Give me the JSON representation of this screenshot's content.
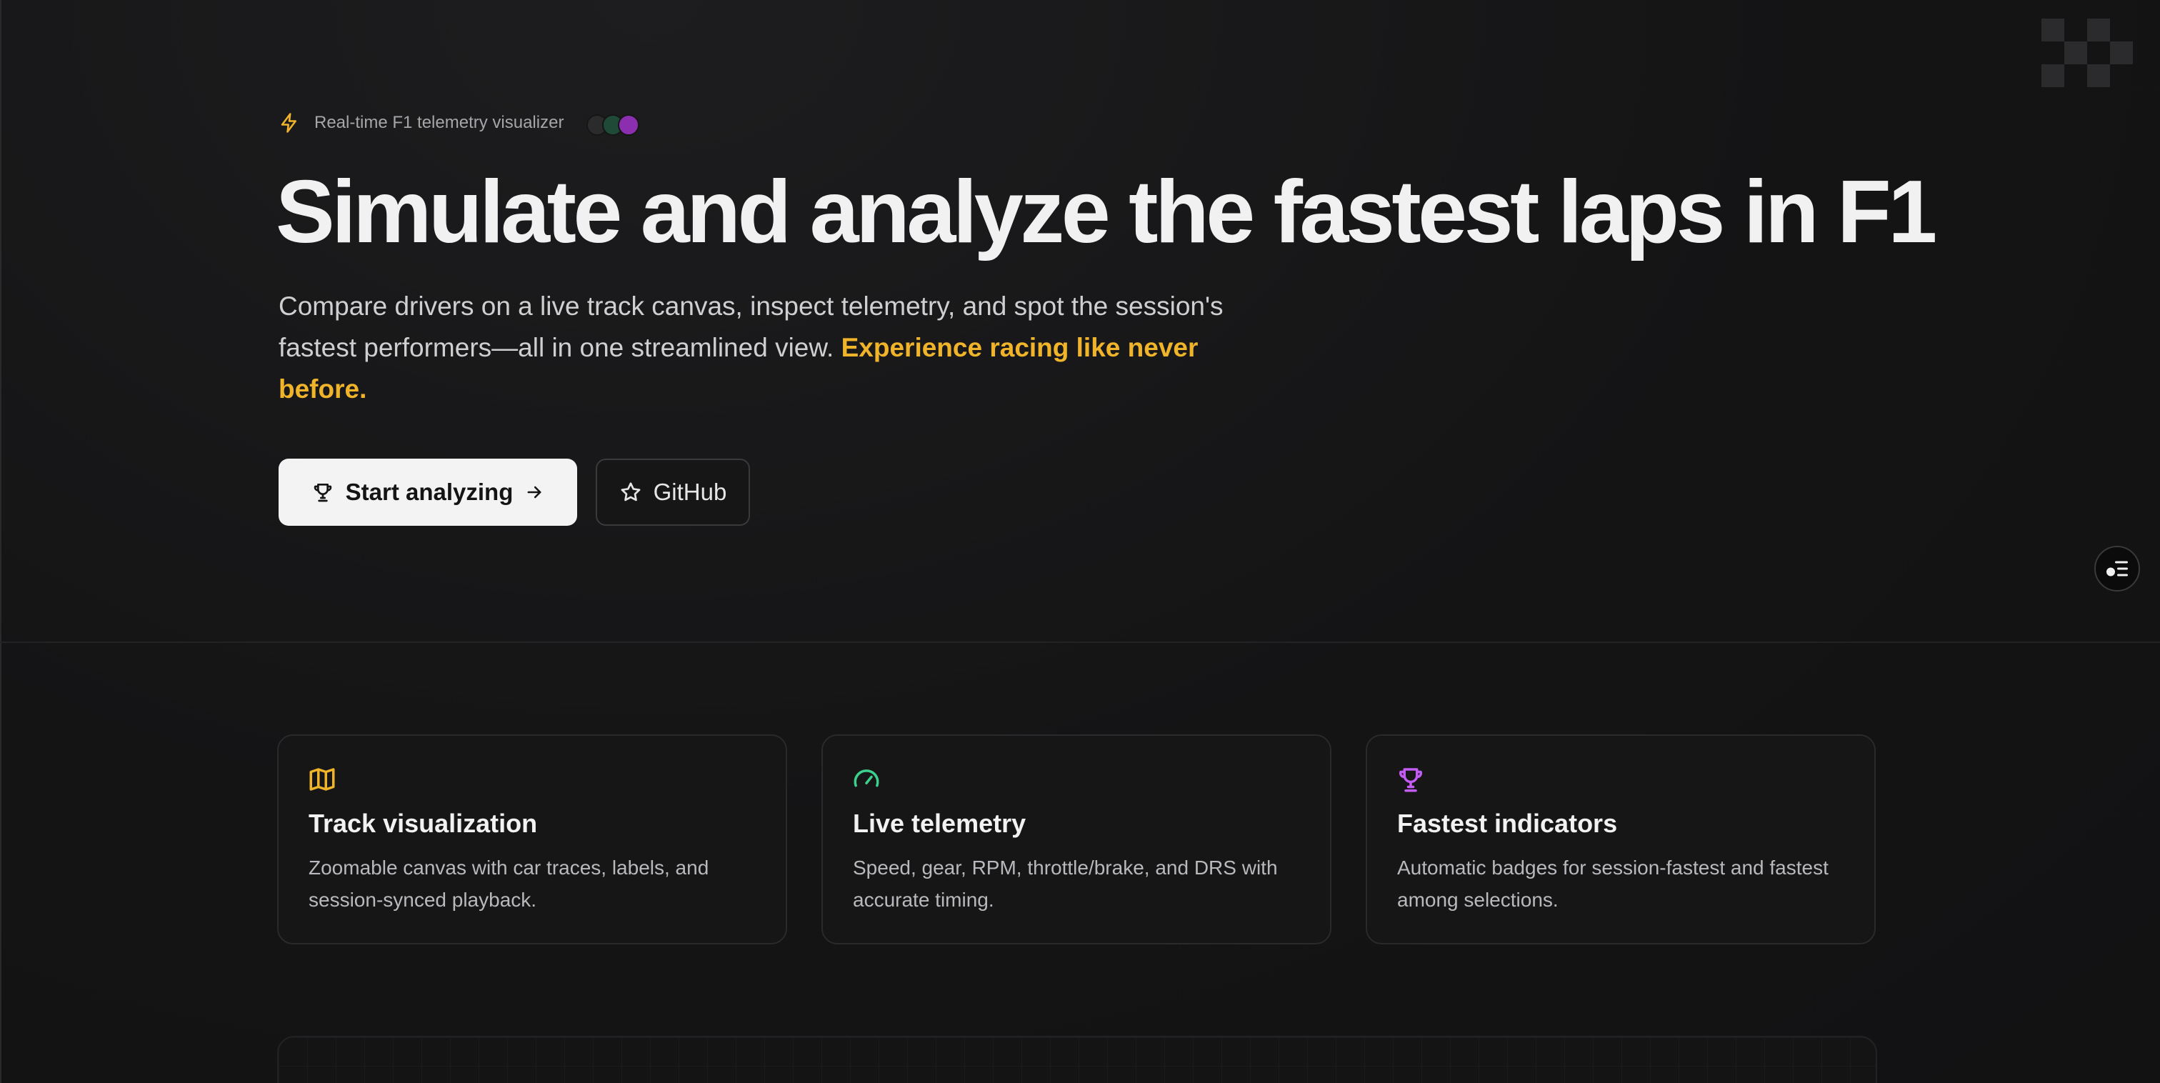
{
  "hero": {
    "eyebrow": "Real-time F1 telemetry visualizer",
    "headline": "Simulate and analyze the fastest laps in F1",
    "subtext": "Compare drivers on a live track canvas, inspect telemetry, and spot the session's fastest performers—all in one streamlined view.",
    "subtext_highlight": "Experience racing like never before.",
    "primary_button": "Start analyzing",
    "secondary_button": "GitHub"
  },
  "features": [
    {
      "icon": "map-icon",
      "title": "Track visualization",
      "description": "Zoomable canvas with car traces, labels, and session-synced playback."
    },
    {
      "icon": "gauge-icon",
      "title": "Live telemetry",
      "description": "Speed, gear, RPM, throttle/brake, and DRS with accurate timing."
    },
    {
      "icon": "trophy-icon",
      "title": "Fastest indicators",
      "description": "Automatic badges for session-fastest and fastest among selections."
    }
  ],
  "colors": {
    "background": "#121213",
    "accent_yellow": "#f0b42a",
    "accent_green": "#3ccf8e",
    "accent_purple": "#c25cf2",
    "primary_button_bg": "#f3f3f3"
  }
}
